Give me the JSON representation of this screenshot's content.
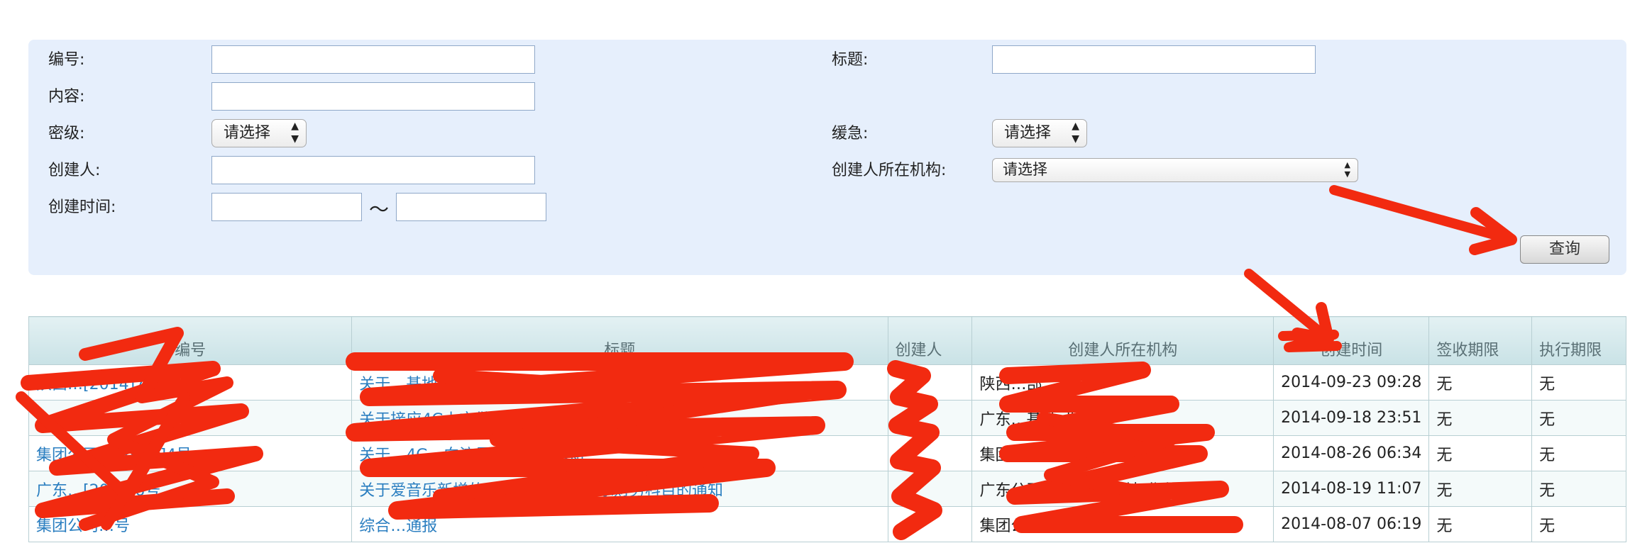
{
  "search": {
    "fields": {
      "number_label": "编号:",
      "title_label": "标题:",
      "content_label": "内容:",
      "secret_label": "密级:",
      "urgency_label": "缓急:",
      "creator_label": "创建人:",
      "org_label": "创建人所在机构:",
      "time_label": "创建时间:"
    },
    "secret_select": "请选择",
    "urgency_select": "请选择",
    "org_select": "请选择",
    "range_separator": "～",
    "query_button": "查询"
  },
  "table": {
    "headers": [
      "编号",
      "标题",
      "创建人",
      "创建人所在机构",
      "创建时间",
      "签收期限",
      "执行期限"
    ],
    "rows": [
      {
        "number": "陕西…[2014]7号",
        "title": "关于…基地业务理赔账号无法正常使用的…",
        "creator": "",
        "org": "陕西…部",
        "time": "2014-09-23 09:28",
        "sign": "无",
        "exec": "无"
      },
      {
        "number": "",
        "title": "关于接应4G上市做好爱音乐…的通知",
        "creator": "",
        "org": "广东…基地 业务部",
        "time": "2014-09-18 23:51",
        "sign": "无",
        "exec": "无"
      },
      {
        "number": "集团公司…[2014]4号",
        "title": "关于…4G…向流量销售…的通知",
        "creator": "",
        "org": "集团公司…运营中心",
        "time": "2014-08-26 06:34",
        "sign": "无",
        "exec": "无"
      },
      {
        "number": "广东…[2014]6号",
        "title": "关于爱音乐新增的SPID配置进爱音乐财务科目的通知",
        "creator": "",
        "org": "广东公司 音乐产品基地 业务部",
        "time": "2014-08-19 11:07",
        "sign": "无",
        "exec": "无"
      },
      {
        "number": "集团公司…号",
        "title": "综合…通报",
        "creator": "",
        "org": "集团公司…运营中心",
        "time": "2014-08-07 06:19",
        "sign": "无",
        "exec": "无"
      }
    ]
  },
  "colors": {
    "panel_bg": "#e6effc",
    "link": "#2a7ec0",
    "annotation_red": "#f22a10"
  },
  "icons": [
    "select-arrows-icon",
    "annotation-arrow-icon"
  ]
}
